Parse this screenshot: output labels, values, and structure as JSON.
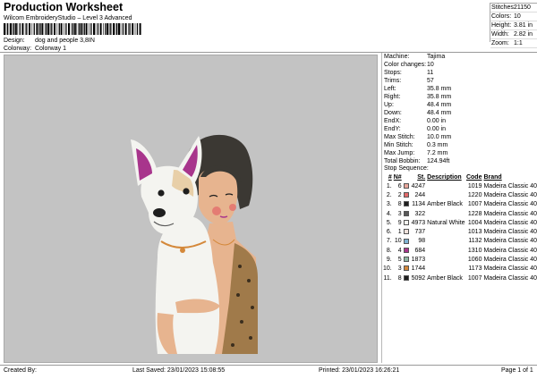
{
  "header": {
    "title": "Production Worksheet",
    "software": "Wilcom EmbroideryStudio – Level 3 Advanced",
    "design_label": "Design:",
    "design_value": "dog and people 3,8IN",
    "colorway_label": "Colorway:",
    "colorway_value": "Colorway 1"
  },
  "stats": [
    {
      "key": "Stitches:",
      "value": "21150"
    },
    {
      "key": "Colors:",
      "value": "10"
    },
    {
      "key": "Height:",
      "value": "3.81 in"
    },
    {
      "key": "Width:",
      "value": "2.82 in"
    },
    {
      "key": "Zoom:",
      "value": "1:1"
    }
  ],
  "machine": [
    {
      "key": "Machine:",
      "value": "Tajima"
    },
    {
      "key": "Color changes:",
      "value": "10"
    },
    {
      "key": "Stops:",
      "value": "11"
    },
    {
      "key": "Trims:",
      "value": "57"
    },
    {
      "key": "Left:",
      "value": "35.8 mm"
    },
    {
      "key": "Right:",
      "value": "35.8 mm"
    },
    {
      "key": "Up:",
      "value": "48.4 mm"
    },
    {
      "key": "Down:",
      "value": "48.4 mm"
    },
    {
      "key": "EndX:",
      "value": "0.00 in"
    },
    {
      "key": "EndY:",
      "value": "0.00 in"
    },
    {
      "key": "Max Stitch:",
      "value": "10.0 mm"
    },
    {
      "key": "Min Stitch:",
      "value": "0.3 mm"
    },
    {
      "key": "Max Jump:",
      "value": "7.2 mm"
    },
    {
      "key": "Total Bobbin:",
      "value": "124.94ft"
    }
  ],
  "sequence": {
    "label": "Stop Sequence:",
    "headers": {
      "idx": "#",
      "n": "N#",
      "st": "St.",
      "desc": "Description",
      "code": "Code",
      "brand": "Brand"
    },
    "rows": [
      {
        "idx": "1.",
        "n": "6",
        "color": "#e8a69b",
        "st": "4247",
        "desc": "",
        "code": "1019",
        "brand": "Madeira Classic 40"
      },
      {
        "idx": "2.",
        "n": "2",
        "color": "#e36a6a",
        "st": "244",
        "desc": "",
        "code": "1220",
        "brand": "Madeira Classic 40"
      },
      {
        "idx": "3.",
        "n": "8",
        "color": "#1e1e1e",
        "st": "1134",
        "desc": "Amber Black",
        "code": "1007",
        "brand": "Madeira Classic 40"
      },
      {
        "idx": "4.",
        "n": "3",
        "color": "#595959",
        "st": "322",
        "desc": "",
        "code": "1228",
        "brand": "Madeira Classic 40"
      },
      {
        "idx": "5.",
        "n": "9",
        "color": "#f4f4f0",
        "st": "4973",
        "desc": "Natural White",
        "code": "1004",
        "brand": "Madeira Classic 40"
      },
      {
        "idx": "6.",
        "n": "1",
        "color": "#f0e2dc",
        "st": "737",
        "desc": "",
        "code": "1013",
        "brand": "Madeira Classic 40"
      },
      {
        "idx": "7.",
        "n": "10",
        "color": "#7fb3d3",
        "st": "98",
        "desc": "",
        "code": "1132",
        "brand": "Madeira Classic 40"
      },
      {
        "idx": "8.",
        "n": "4",
        "color": "#a8358c",
        "st": "684",
        "desc": "",
        "code": "1310",
        "brand": "Madeira Classic 40"
      },
      {
        "idx": "9.",
        "n": "5",
        "color": "#8fb7a3",
        "st": "1873",
        "desc": "",
        "code": "1060",
        "brand": "Madeira Classic 40"
      },
      {
        "idx": "10.",
        "n": "3",
        "color": "#d4883a",
        "st": "1744",
        "desc": "",
        "code": "1173",
        "brand": "Madeira Classic 40"
      },
      {
        "idx": "11.",
        "n": "8",
        "color": "#1e1e1e",
        "st": "5092",
        "desc": "Amber Black",
        "code": "1007",
        "brand": "Madeira Classic 40"
      }
    ]
  },
  "footer": {
    "created_by": "Created By:",
    "last_saved": "Last Saved: 23/01/2023 15:08:55",
    "printed": "Printed: 23/01/2023 16:26:21",
    "page": "Page 1 of 1"
  },
  "colors": {
    "canvas": "#c3c3c3",
    "panel_border": "#b8b8b8"
  }
}
